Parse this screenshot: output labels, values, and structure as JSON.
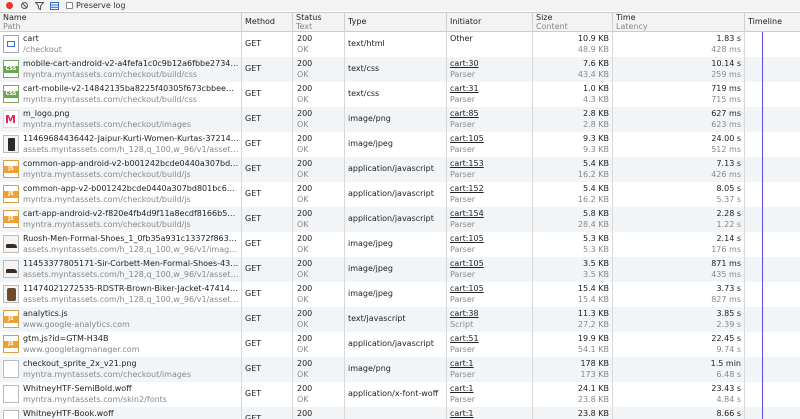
{
  "toolbar": {
    "preserve_log_label": "Preserve log"
  },
  "columns": {
    "name": {
      "l1": "Name",
      "l2": "Path"
    },
    "method": {
      "l1": "Method"
    },
    "status": {
      "l1": "Status",
      "l2": "Text"
    },
    "type": {
      "l1": "Type"
    },
    "initiator": {
      "l1": "Initiator"
    },
    "size": {
      "l1": "Size",
      "l2": "Content"
    },
    "time": {
      "l1": "Time",
      "l2": "Latency"
    },
    "timeline": {
      "l1": "Timeline"
    }
  },
  "accent": {
    "timeline_marker": "#5a4ee6",
    "record": "#e8352f"
  },
  "rows": [
    {
      "icon": "document-icon",
      "name": "cart",
      "path": "/checkout",
      "method": "GET",
      "status": "200",
      "status_text": "OK",
      "type": "text/html",
      "initiator": "Other",
      "initiator_link": false,
      "initiator_sub": "",
      "size": "10.9 KB",
      "content": "48.9 KB",
      "time": "1.83 s",
      "latency": "428 ms"
    },
    {
      "icon": "css-icon",
      "name": "mobile-cart-android-v2-a4fefa1c0c9b12a6fbbe2734222b2f9…",
      "path": "myntra.myntassets.com/checkout/build/css",
      "method": "GET",
      "status": "200",
      "status_text": "OK",
      "type": "text/css",
      "initiator": "cart:30",
      "initiator_link": true,
      "initiator_sub": "Parser",
      "size": "7.6 KB",
      "content": "43.4 KB",
      "time": "10.14 s",
      "latency": "259 ms"
    },
    {
      "icon": "css-icon",
      "name": "cart-mobile-v2-14842135ba8225f40305f673cbbee88601100…",
      "path": "myntra.myntassets.com/checkout/build/css",
      "method": "GET",
      "status": "200",
      "status_text": "OK",
      "type": "text/css",
      "initiator": "cart:31",
      "initiator_link": true,
      "initiator_sub": "Parser",
      "size": "1.0 KB",
      "content": "4.3 KB",
      "time": "719 ms",
      "latency": "715 ms"
    },
    {
      "icon": "myntra-logo-icon",
      "name": "m_logo.png",
      "path": "myntra.myntassets.com/checkout/images",
      "method": "GET",
      "status": "200",
      "status_text": "OK",
      "type": "image/png",
      "initiator": "cart:85",
      "initiator_link": true,
      "initiator_sub": "Parser",
      "size": "2.8 KB",
      "content": "2.8 KB",
      "time": "627 ms",
      "latency": "623 ms"
    },
    {
      "icon": "kurti-thumbnail-icon",
      "name": "11469684436442-Jaipur-Kurti-Women-Kurtas-37214696844…",
      "path": "assets.myntassets.com/h_128,q_100,w_96/v1/assets/images/1…",
      "method": "GET",
      "status": "200",
      "status_text": "OK",
      "type": "image/jpeg",
      "initiator": "cart:105",
      "initiator_link": true,
      "initiator_sub": "Parser",
      "size": "9.3 KB",
      "content": "9.3 KB",
      "time": "24.00 s",
      "latency": "512 ms"
    },
    {
      "icon": "js-icon",
      "name": "common-app-android-v2-b001242bcde0440a307bd801bc67…",
      "path": "myntra.myntassets.com/checkout/build/js",
      "method": "GET",
      "status": "200",
      "status_text": "OK",
      "type": "application/javascript",
      "initiator": "cart:153",
      "initiator_link": true,
      "initiator_sub": "Parser",
      "size": "5.4 KB",
      "content": "16.2 KB",
      "time": "7.13 s",
      "latency": "426 ms"
    },
    {
      "icon": "js-icon",
      "name": "common-app-v2-b001242bcde0440a307bd801bc67f9cb548…",
      "path": "myntra.myntassets.com/checkout/build/js",
      "method": "GET",
      "status": "200",
      "status_text": "OK",
      "type": "application/javascript",
      "initiator": "cart:152",
      "initiator_link": true,
      "initiator_sub": "Parser",
      "size": "5.4 KB",
      "content": "16.2 KB",
      "time": "8.05 s",
      "latency": "5.37 s"
    },
    {
      "icon": "js-icon",
      "name": "cart-app-android-v2-f820e4fb4d9f11a8ecdf8166b59b54f4e…",
      "path": "myntra.myntassets.com/checkout/build/js",
      "method": "GET",
      "status": "200",
      "status_text": "OK",
      "type": "application/javascript",
      "initiator": "cart:154",
      "initiator_link": true,
      "initiator_sub": "Parser",
      "size": "5.8 KB",
      "content": "28.4 KB",
      "time": "2.28 s",
      "latency": "1.22 s"
    },
    {
      "icon": "shoe-thumbnail-icon",
      "name": "Ruosh-Men-Formal-Shoes_1_0fb35a931c13372f863db90ee03…",
      "path": "assets.myntassets.com/h_128,q_100,w_96/v1/image/style/prope…",
      "method": "GET",
      "status": "200",
      "status_text": "OK",
      "type": "image/jpeg",
      "initiator": "cart:105",
      "initiator_link": true,
      "initiator_sub": "Parser",
      "size": "5.3 KB",
      "content": "5.3 KB",
      "time": "2.14 s",
      "latency": "176 ms"
    },
    {
      "icon": "shoe-thumbnail-icon",
      "name": "11453377805171-Sir-Corbett-Men-Formal-Shoes-43914533…",
      "path": "assets.myntassets.com/h_128,q_100,w_96/v1/assets/images/11…",
      "method": "GET",
      "status": "200",
      "status_text": "OK",
      "type": "image/jpeg",
      "initiator": "cart:105",
      "initiator_link": true,
      "initiator_sub": "Parser",
      "size": "3.5 KB",
      "content": "3.5 KB",
      "time": "871 ms",
      "latency": "435 ms"
    },
    {
      "icon": "jacket-thumbnail-icon",
      "name": "11474021272535-RDSTR-Brown-Biker-Jacket-474147402127…",
      "path": "assets.myntassets.com/h_128,q_100,w_96/v1/assets/images/11…",
      "method": "GET",
      "status": "200",
      "status_text": "OK",
      "type": "image/jpeg",
      "initiator": "cart:105",
      "initiator_link": true,
      "initiator_sub": "Parser",
      "size": "15.4 KB",
      "content": "15.4 KB",
      "time": "3.73 s",
      "latency": "827 ms"
    },
    {
      "icon": "js-icon",
      "name": "analytics.js",
      "path": "www.google-analytics.com",
      "method": "GET",
      "status": "200",
      "status_text": "OK",
      "type": "text/javascript",
      "initiator": "cart:38",
      "initiator_link": true,
      "initiator_sub": "Script",
      "size": "11.3 KB",
      "content": "27.2 KB",
      "time": "3.85 s",
      "latency": "2.39 s"
    },
    {
      "icon": "js-icon",
      "name": "gtm.js?id=GTM-H34B",
      "path": "www.googletagmanager.com",
      "method": "GET",
      "status": "200",
      "status_text": "OK",
      "type": "application/javascript",
      "initiator": "cart:51",
      "initiator_link": true,
      "initiator_sub": "Parser",
      "size": "19.9 KB",
      "content": "54.1 KB",
      "time": "22.45 s",
      "latency": "9.74 s"
    },
    {
      "icon": "image-icon",
      "name": "checkout_sprite_2x_v21.png",
      "path": "myntra.myntassets.com/checkout/images",
      "method": "GET",
      "status": "200",
      "status_text": "OK",
      "type": "image/png",
      "initiator": "cart:1",
      "initiator_link": true,
      "initiator_sub": "Parser",
      "size": "178 KB",
      "content": "173 KB",
      "time": "1.5 min",
      "latency": "6.48 s"
    },
    {
      "icon": "font-file-icon",
      "name": "WhitneyHTF-SemiBold.woff",
      "path": "myntra.myntassets.com/skin2/fonts",
      "method": "GET",
      "status": "200",
      "status_text": "OK",
      "type": "application/x-font-woff",
      "initiator": "cart:1",
      "initiator_link": true,
      "initiator_sub": "Parser",
      "size": "24.1 KB",
      "content": "23.8 KB",
      "time": "23.43 s",
      "latency": "4.84 s"
    },
    {
      "icon": "font-file-icon",
      "name": "WhitneyHTF-Book.woff",
      "path": "",
      "method": "GET",
      "status": "200",
      "status_text": "",
      "type": "",
      "initiator": "cart:1",
      "initiator_link": true,
      "initiator_sub": "",
      "size": "23.8 KB",
      "content": "",
      "time": "8.66 s",
      "latency": ""
    }
  ]
}
